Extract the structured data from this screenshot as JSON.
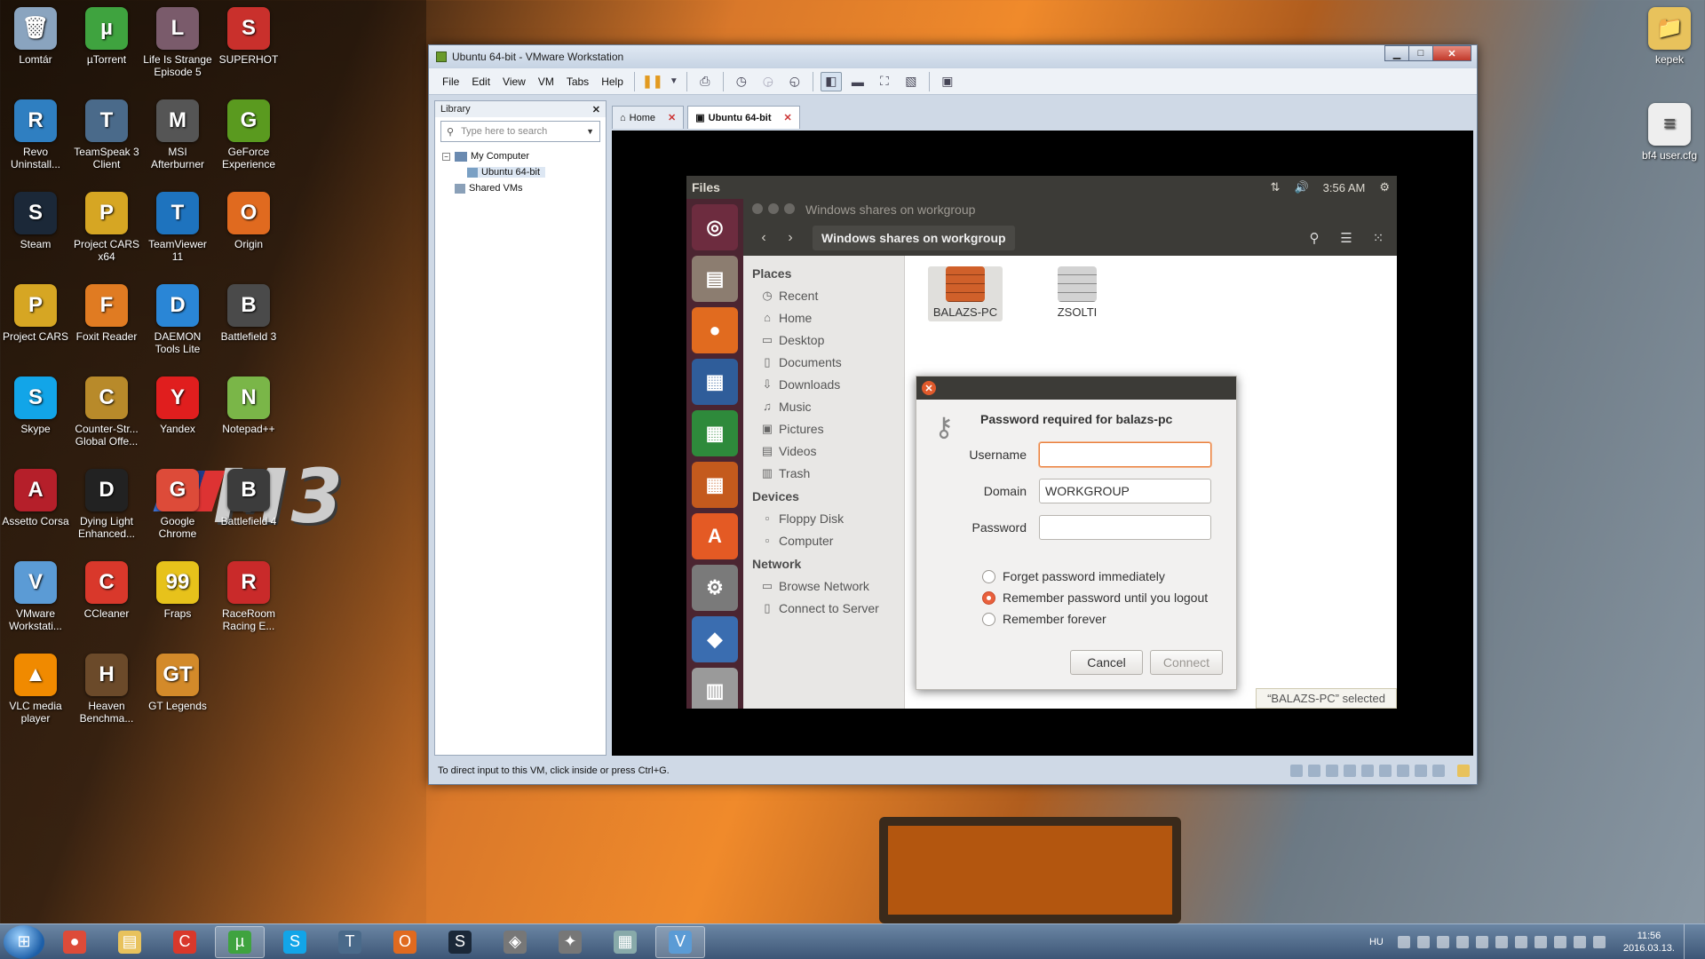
{
  "desktop": {
    "left_icons": [
      {
        "label": "Lomtár",
        "color": "#8aa4bf",
        "glyph": "🗑"
      },
      {
        "label": "µTorrent",
        "color": "#3fa33f",
        "glyph": "µ"
      },
      {
        "label": "Life Is Strange Episode 5",
        "color": "#7a5b6b",
        "glyph": "L"
      },
      {
        "label": "SUPERHOT",
        "color": "#c9302c",
        "glyph": "S"
      },
      {
        "label": "Revo Uninstall...",
        "color": "#2f7fc1",
        "glyph": "R"
      },
      {
        "label": "TeamSpeak 3 Client",
        "color": "#4a6a8a",
        "glyph": "T"
      },
      {
        "label": "MSI Afterburner",
        "color": "#555",
        "glyph": "M"
      },
      {
        "label": "GeForce Experience",
        "color": "#5a9a1f",
        "glyph": "G"
      },
      {
        "label": "Steam",
        "color": "#1b2838",
        "glyph": "S"
      },
      {
        "label": "Project CARS x64",
        "color": "#d6a623",
        "glyph": "P"
      },
      {
        "label": "TeamViewer 11",
        "color": "#1e73be",
        "glyph": "T"
      },
      {
        "label": "Origin",
        "color": "#e06a1f",
        "glyph": "O"
      },
      {
        "label": "Project CARS",
        "color": "#d6a623",
        "glyph": "P"
      },
      {
        "label": "Foxit Reader",
        "color": "#e07b22",
        "glyph": "F"
      },
      {
        "label": "DAEMON Tools Lite",
        "color": "#2a86d6",
        "glyph": "D"
      },
      {
        "label": "Battlefield 3",
        "color": "#4a4a4a",
        "glyph": "B"
      },
      {
        "label": "Skype",
        "color": "#12a5e8",
        "glyph": "S"
      },
      {
        "label": "Counter-Str... Global Offe...",
        "color": "#b88a2a",
        "glyph": "C"
      },
      {
        "label": "Yandex",
        "color": "#e01e1e",
        "glyph": "Y"
      },
      {
        "label": "Notepad++",
        "color": "#7ab648",
        "glyph": "N"
      },
      {
        "label": "Assetto Corsa",
        "color": "#b51f2a",
        "glyph": "A"
      },
      {
        "label": "Dying Light Enhanced...",
        "color": "#222",
        "glyph": "D"
      },
      {
        "label": "Google Chrome",
        "color": "#dd4b39",
        "glyph": "G"
      },
      {
        "label": "Battlefield 4",
        "color": "#3c3c3c",
        "glyph": "B"
      },
      {
        "label": "VMware Workstati...",
        "color": "#5b9bd5",
        "glyph": "V"
      },
      {
        "label": "CCleaner",
        "color": "#d9382b",
        "glyph": "C"
      },
      {
        "label": "Fraps",
        "color": "#e7c21b",
        "glyph": "99"
      },
      {
        "label": "RaceRoom Racing E...",
        "color": "#c92a2a",
        "glyph": "R"
      },
      {
        "label": "VLC media player",
        "color": "#f08a00",
        "glyph": "▲"
      },
      {
        "label": "Heaven Benchma...",
        "color": "#6b4a2a",
        "glyph": "H"
      },
      {
        "label": "GT Legends",
        "color": "#d38a2a",
        "glyph": "GT"
      }
    ],
    "right_icons": [
      {
        "label": "kepek",
        "color": "#e8c25c",
        "glyph": "📁"
      },
      {
        "label": "bf4 user.cfg",
        "color": "#eeeeee",
        "glyph": "≡"
      }
    ],
    "wallpaper_text": "M3"
  },
  "vmware": {
    "title": "Ubuntu 64-bit - VMware Workstation",
    "menu": [
      "File",
      "Edit",
      "View",
      "VM",
      "Tabs",
      "Help"
    ],
    "library": {
      "title": "Library",
      "search_placeholder": "Type here to search",
      "tree": [
        {
          "label": "My Computer"
        },
        {
          "label": "Ubuntu 64-bit"
        },
        {
          "label": "Shared VMs"
        }
      ]
    },
    "tabs": [
      {
        "label": "Home"
      },
      {
        "label": "Ubuntu 64-bit"
      }
    ],
    "status_text": "To direct input to this VM, click inside or press Ctrl+G."
  },
  "ubuntu": {
    "panel": {
      "app_name": "Files",
      "time": "3:56 AM"
    },
    "window_title": "Windows shares on workgroup",
    "breadcrumb": "Windows shares on workgroup",
    "sidebar": {
      "places_heading": "Places",
      "places": [
        {
          "label": "Recent",
          "icon": "◷"
        },
        {
          "label": "Home",
          "icon": "⌂"
        },
        {
          "label": "Desktop",
          "icon": "▭"
        },
        {
          "label": "Documents",
          "icon": "▯"
        },
        {
          "label": "Downloads",
          "icon": "⇩"
        },
        {
          "label": "Music",
          "icon": "♫"
        },
        {
          "label": "Pictures",
          "icon": "▣"
        },
        {
          "label": "Videos",
          "icon": "▤"
        },
        {
          "label": "Trash",
          "icon": "▥"
        }
      ],
      "devices_heading": "Devices",
      "devices": [
        {
          "label": "Floppy Disk",
          "icon": "▫"
        },
        {
          "label": "Computer",
          "icon": "▫"
        }
      ],
      "network_heading": "Network",
      "network": [
        {
          "label": "Browse Network",
          "icon": "▭"
        },
        {
          "label": "Connect to Server",
          "icon": "▯"
        }
      ]
    },
    "shares": [
      {
        "label": "BALAZS-PC",
        "color": "#d0602a"
      },
      {
        "label": "ZSOLTI",
        "color": "#c8c8c8"
      }
    ],
    "selection_status": "“BALAZS-PC” selected",
    "dialog": {
      "heading": "Password required for balazs-pc",
      "username_label": "Username",
      "username_value": "",
      "domain_label": "Domain",
      "domain_value": "WORKGROUP",
      "password_label": "Password",
      "password_value": "",
      "options": [
        {
          "label": "Forget password immediately",
          "selected": false
        },
        {
          "label": "Remember password until you logout",
          "selected": true
        },
        {
          "label": "Remember forever",
          "selected": false
        }
      ],
      "cancel_label": "Cancel",
      "connect_label": "Connect"
    }
  },
  "taskbar": {
    "apps": [
      {
        "name": "chrome",
        "color": "#dd4b39",
        "glyph": "●"
      },
      {
        "name": "explorer",
        "color": "#e8c25c",
        "glyph": "▤"
      },
      {
        "name": "ccleaner",
        "color": "#d9382b",
        "glyph": "C"
      },
      {
        "name": "utorrent",
        "color": "#3fa33f",
        "glyph": "µ"
      },
      {
        "name": "skype",
        "color": "#12a5e8",
        "glyph": "S"
      },
      {
        "name": "teamspeak",
        "color": "#4a6a8a",
        "glyph": "T"
      },
      {
        "name": "origin",
        "color": "#e06a1f",
        "glyph": "O"
      },
      {
        "name": "steam",
        "color": "#1b2838",
        "glyph": "S"
      },
      {
        "name": "app9",
        "color": "#777",
        "glyph": "◈"
      },
      {
        "name": "app10",
        "color": "#777",
        "glyph": "✦"
      },
      {
        "name": "calculator",
        "color": "#8aa",
        "glyph": "▦"
      },
      {
        "name": "vmware",
        "color": "#5b9bd5",
        "glyph": "V"
      }
    ],
    "language": "HU",
    "time": "11:56",
    "date": "2016.03.13."
  }
}
